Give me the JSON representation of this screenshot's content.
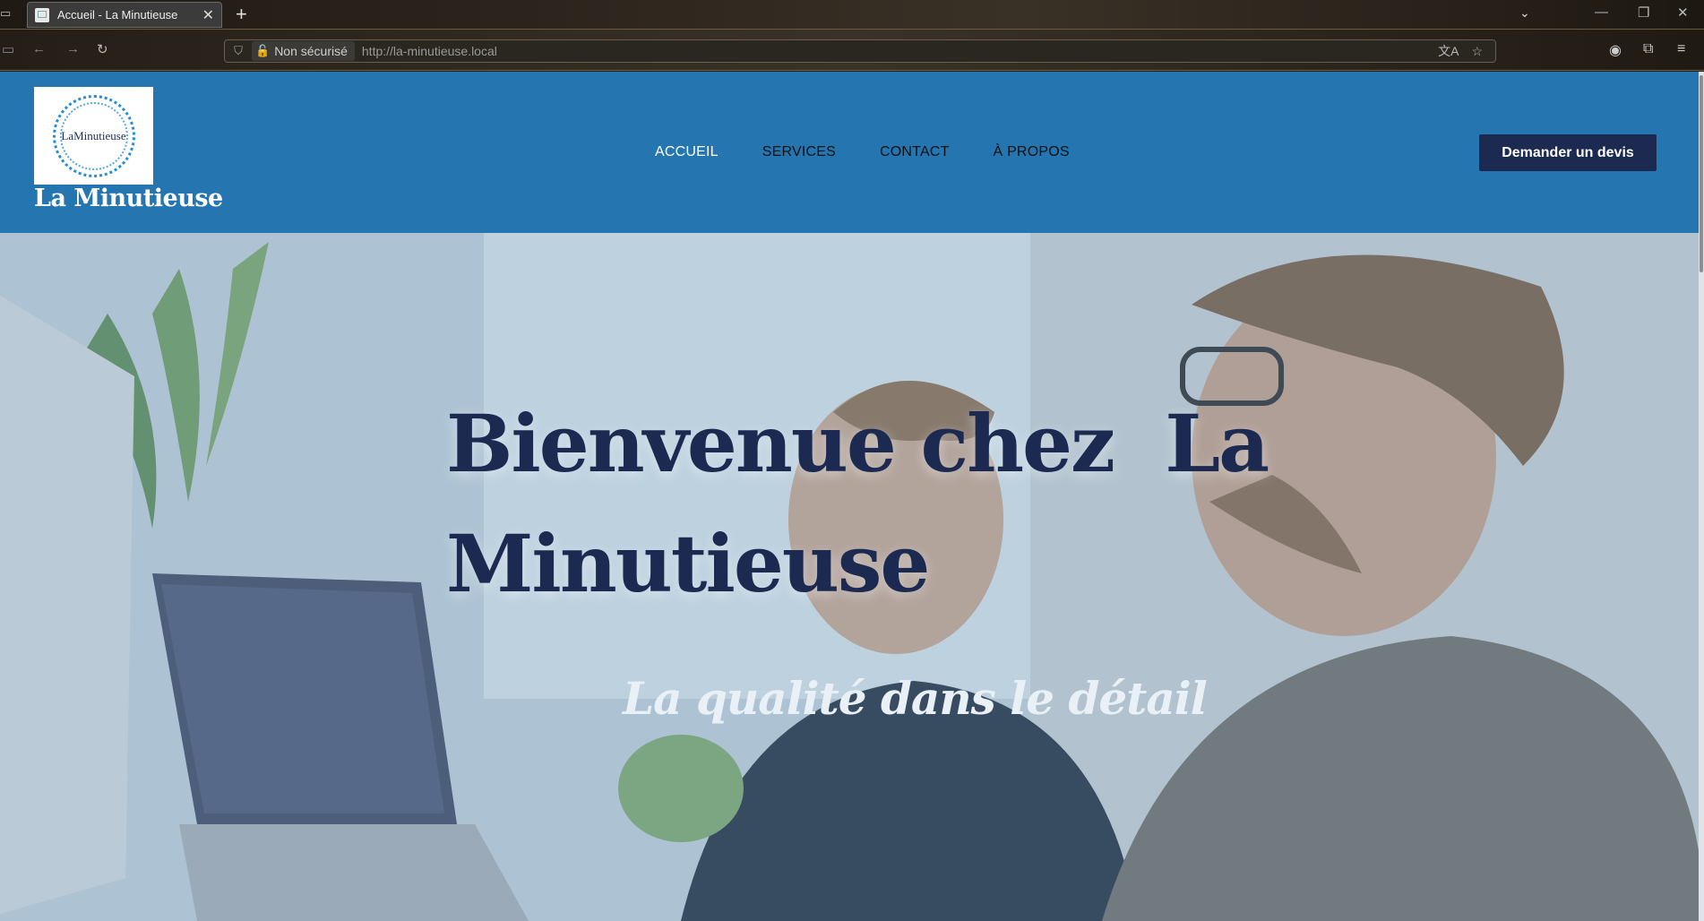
{
  "browser": {
    "tab": {
      "title": "Accueil - La Minutieuse"
    },
    "urlbar": {
      "security_label": "Non sécurisé",
      "url": "http://la-minutieuse.local"
    }
  },
  "site": {
    "logo": {
      "line1": "La",
      "line2": "Minutieuse"
    },
    "name": "La Minutieuse",
    "nav": [
      {
        "label": "ACCUEIL",
        "active": true
      },
      {
        "label": "SERVICES",
        "active": false
      },
      {
        "label": "CONTACT",
        "active": false
      },
      {
        "label": "À PROPOS",
        "active": false
      }
    ],
    "cta_label": "Demander un devis"
  },
  "hero": {
    "title_line1": "Bienvenue chez  La",
    "title_line2": "Minutieuse",
    "tagline": "La qualité dans le détail"
  },
  "colors": {
    "header_bg": "#2475b0",
    "cta_bg": "#1c2a52",
    "title_color": "#1c2a52"
  }
}
